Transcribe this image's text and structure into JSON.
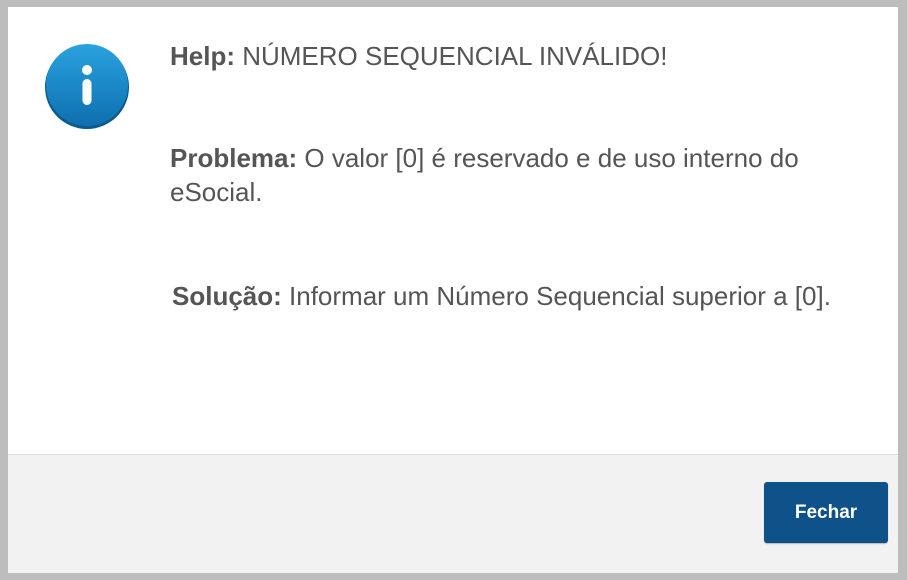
{
  "dialog": {
    "icon": "info-icon",
    "help_label": "Help:",
    "help_text": " NÚMERO SEQUENCIAL INVÁLIDO!",
    "problem_label": "Problema:",
    "problem_text": " O valor [0] é reservado e de uso interno do eSocial.",
    "solution_label": "Solução:",
    "solution_text": " Informar um Número Sequencial superior a [0]."
  },
  "footer": {
    "close_label": "Fechar"
  },
  "colors": {
    "icon_blue": "#1a8fd0",
    "button_blue": "#0f5289",
    "text_gray": "#555555",
    "footer_bg": "#f2f2f3"
  }
}
